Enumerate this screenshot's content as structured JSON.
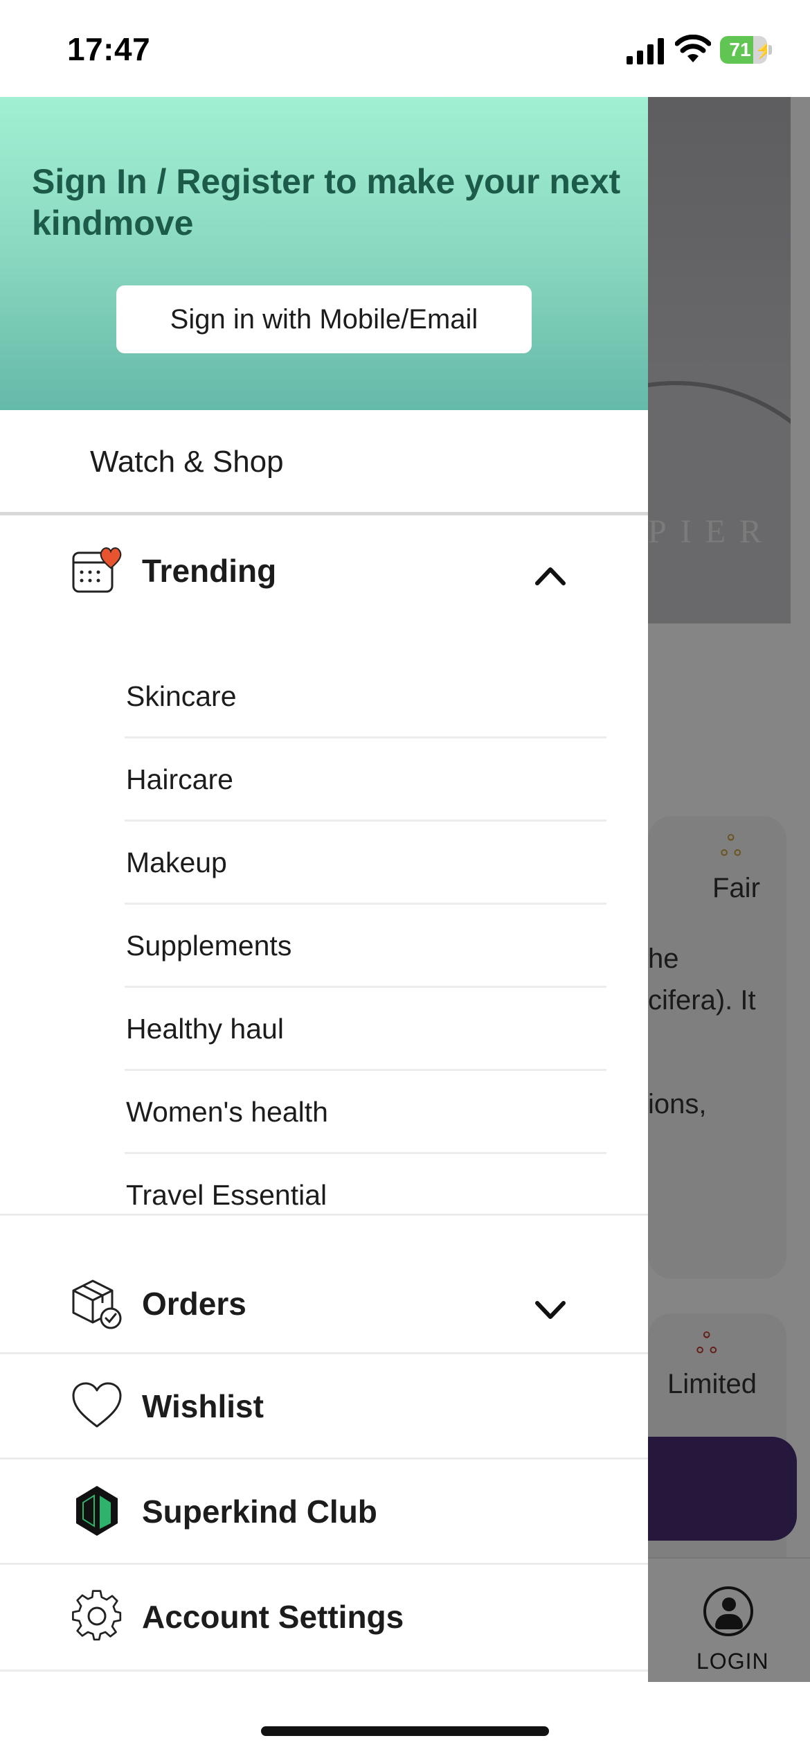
{
  "status_bar": {
    "time": "17:47",
    "battery_level": "71",
    "battery_fraction": 0.71,
    "icons": [
      "cellular-signal-icon",
      "wifi-icon",
      "battery-charging-icon"
    ]
  },
  "drawer": {
    "header": {
      "title": "Sign In / Register to make your next kindmove",
      "signin_button": "Sign in with Mobile/Email",
      "gradient_top": "#a2f0d3",
      "gradient_bottom": "#64b9a8",
      "title_color": "#1c5a4a"
    },
    "watch_shop": {
      "label": "Watch & Shop"
    },
    "trending": {
      "label": "Trending",
      "icon": "calendar-heart-icon",
      "expanded": true,
      "items": [
        "Skincare",
        "Haircare",
        "Makeup",
        "Supplements",
        "Healthy haul",
        "Women's health",
        "Travel Essential"
      ]
    },
    "orders": {
      "label": "Orders",
      "icon": "package-check-icon",
      "expanded": false
    },
    "wishlist": {
      "label": "Wishlist",
      "icon": "heart-icon"
    },
    "superkind_club": {
      "label": "Superkind Club",
      "icon": "superkind-logo-icon"
    },
    "account_settings": {
      "label": "Account Settings",
      "icon": "gear-icon"
    }
  },
  "background_app": {
    "hero_brand": "PIER",
    "rating_1": "Fair",
    "rating_2": "Limited",
    "snippets": [
      "he",
      "cifera). It",
      "ions,"
    ],
    "login_label": "LOGIN",
    "cta_color": "#4a2e73"
  }
}
